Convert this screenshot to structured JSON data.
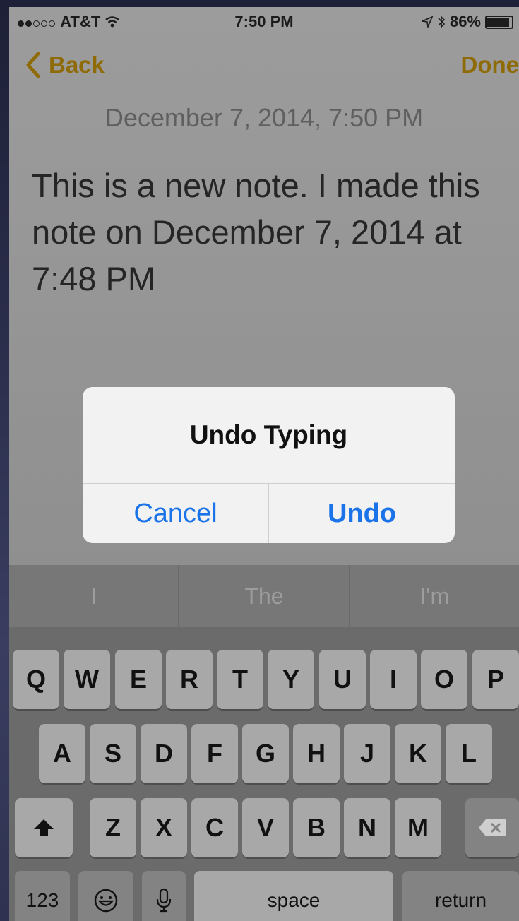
{
  "status_bar": {
    "carrier": "AT&T",
    "time": "7:50 PM",
    "battery": "86%",
    "battery_level": 0.86
  },
  "nav": {
    "back_label": "Back",
    "done_label": "Done"
  },
  "note": {
    "date": "December 7, 2014, 7:50 PM",
    "body": "This is a new note. I made this note on December 7, 2014 at 7:48 PM"
  },
  "alert": {
    "title": "Undo Typing",
    "cancel_label": "Cancel",
    "undo_label": "Undo"
  },
  "keyboard": {
    "suggestions": [
      "I",
      "The",
      "I'm"
    ],
    "row1": [
      "Q",
      "W",
      "E",
      "R",
      "T",
      "Y",
      "U",
      "I",
      "O",
      "P"
    ],
    "row2": [
      "A",
      "S",
      "D",
      "F",
      "G",
      "H",
      "J",
      "K",
      "L"
    ],
    "row3": [
      "Z",
      "X",
      "C",
      "V",
      "B",
      "N",
      "M"
    ],
    "numbers_label": "123",
    "space_label": "space",
    "return_label": "return",
    "icons": [
      "shift-icon",
      "delete-icon",
      "emoji-icon",
      "microphone-icon"
    ]
  },
  "colors": {
    "accent": "#8f6b06",
    "alert_button": "#1a73e8"
  }
}
